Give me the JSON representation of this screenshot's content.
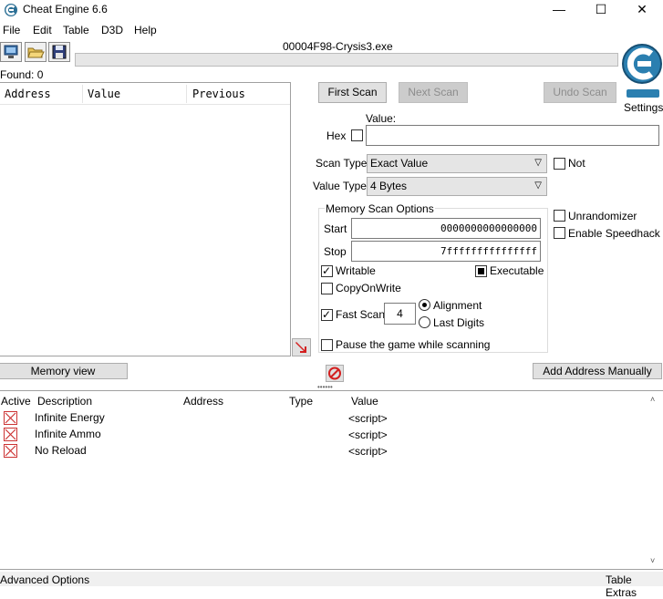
{
  "window": {
    "title": "Cheat Engine 6.6",
    "minimize_glyph": "—",
    "maximize_glyph": "☐",
    "close_glyph": "✕"
  },
  "menu": [
    "File",
    "Edit",
    "Table",
    "D3D",
    "Help"
  ],
  "toolbar": {
    "icons": [
      "open-process-icon",
      "open-file-icon",
      "save-icon"
    ]
  },
  "process": {
    "name": "00004F98-Crysis3.exe",
    "progress": 0
  },
  "settings": {
    "label": "Settings",
    "logo_text": "Cheat Engine"
  },
  "results": {
    "found_label": "Found: 0",
    "columns": [
      "Address",
      "Value",
      "Previous"
    ]
  },
  "scan_buttons": {
    "first_scan": "First Scan",
    "next_scan": "Next Scan",
    "undo_scan": "Undo Scan"
  },
  "value_input": {
    "label": "Value:",
    "hex_label": "Hex",
    "hex_checked": false,
    "value": ""
  },
  "scan_type": {
    "label": "Scan Type",
    "selected": "Exact Value",
    "not_label": "Not",
    "not_checked": false
  },
  "value_type": {
    "label": "Value Type",
    "selected": "4 Bytes"
  },
  "memory_options": {
    "title": "Memory Scan Options",
    "start_label": "Start",
    "start_value": "0000000000000000",
    "stop_label": "Stop",
    "stop_value": "7fffffffffffffff",
    "writable_label": "Writable",
    "writable_checked": true,
    "executable_label": "Executable",
    "executable_state": "indeterminate",
    "copyonwrite_label": "CopyOnWrite",
    "copyonwrite_checked": false,
    "fastscan_label": "Fast Scan",
    "fastscan_checked": true,
    "fastscan_value": "4",
    "alignment_label": "Alignment",
    "lastdigits_label": "Last Digits",
    "alignment_selected": "Alignment",
    "pause_label": "Pause the game while scanning",
    "pause_checked": false
  },
  "extra_options": {
    "unrandomizer_label": "Unrandomizer",
    "unrandomizer_checked": false,
    "speedhack_label": "Enable Speedhack",
    "speedhack_checked": false
  },
  "bottom_buttons": {
    "memory_view": "Memory view",
    "add_address": "Add Address Manually"
  },
  "cheat_table": {
    "columns": [
      "Active",
      "Description",
      "Address",
      "Type",
      "Value"
    ],
    "rows": [
      {
        "active": false,
        "description": "Infinite Energy",
        "address": "",
        "type": "",
        "value": "<script>"
      },
      {
        "active": false,
        "description": "Infinite Ammo",
        "address": "",
        "type": "",
        "value": "<script>"
      },
      {
        "active": false,
        "description": "No Reload",
        "address": "",
        "type": "",
        "value": "<script>"
      }
    ]
  },
  "footer": {
    "advanced_options": "Advanced Options",
    "table_extras": "Table Extras"
  }
}
